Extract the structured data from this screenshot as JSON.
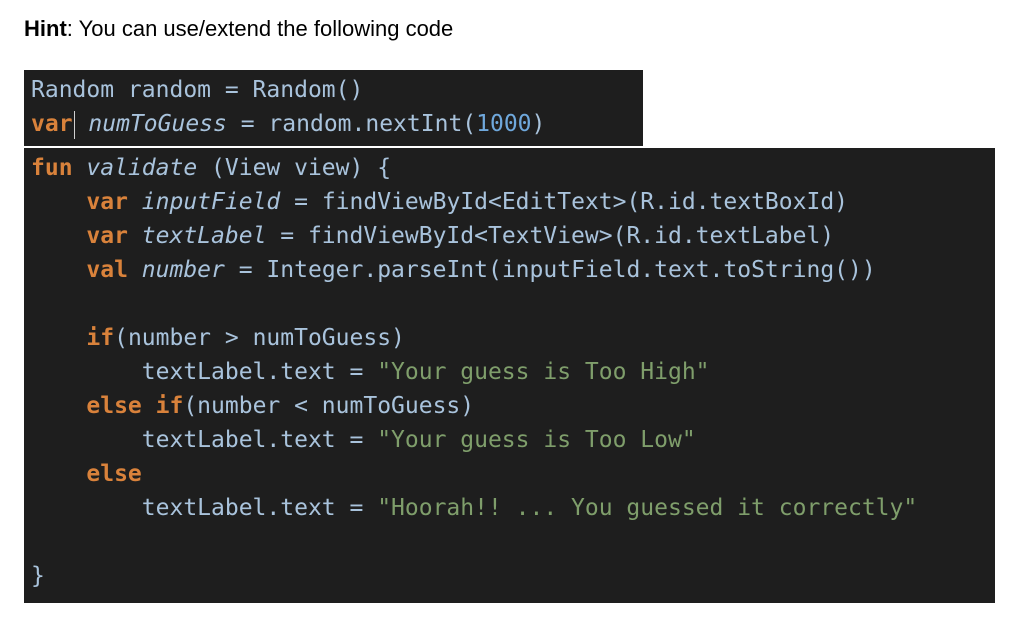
{
  "hint": {
    "label": "Hint",
    "text": ": You can use/extend the following code"
  },
  "code_block_1": {
    "lines": [
      [
        {
          "t": "Random random = Random()",
          "c": "plain"
        }
      ],
      [
        {
          "t": "var",
          "c": "kw"
        },
        {
          "t": "",
          "c": "caret"
        },
        {
          "t": " ",
          "c": "plain"
        },
        {
          "t": "numToGuess",
          "c": "fn"
        },
        {
          "t": " = random.nextInt(",
          "c": "plain"
        },
        {
          "t": "1000",
          "c": "num"
        },
        {
          "t": ")",
          "c": "plain"
        }
      ]
    ]
  },
  "code_block_2": {
    "lines": [
      [
        {
          "t": "fun",
          "c": "kw"
        },
        {
          "t": " ",
          "c": "plain"
        },
        {
          "t": "validate",
          "c": "fn"
        },
        {
          "t": " (View view) {",
          "c": "plain"
        }
      ],
      [
        {
          "t": "    ",
          "c": "plain"
        },
        {
          "t": "var",
          "c": "kw"
        },
        {
          "t": " ",
          "c": "plain"
        },
        {
          "t": "inputField",
          "c": "fn"
        },
        {
          "t": " = findViewById<EditText>(R.id.textBoxId)",
          "c": "plain"
        }
      ],
      [
        {
          "t": "    ",
          "c": "plain"
        },
        {
          "t": "var",
          "c": "kw"
        },
        {
          "t": " ",
          "c": "plain"
        },
        {
          "t": "textLabel",
          "c": "fn"
        },
        {
          "t": " = findViewById<TextView>(R.id.textLabel)",
          "c": "plain"
        }
      ],
      [
        {
          "t": "    ",
          "c": "plain"
        },
        {
          "t": "val",
          "c": "kw"
        },
        {
          "t": " ",
          "c": "plain"
        },
        {
          "t": "number",
          "c": "fn"
        },
        {
          "t": " = Integer.parseInt(inputField.text.toString())",
          "c": "plain"
        }
      ],
      [],
      [
        {
          "t": "    ",
          "c": "plain"
        },
        {
          "t": "if",
          "c": "kw"
        },
        {
          "t": "(number > numToGuess)",
          "c": "plain"
        }
      ],
      [
        {
          "t": "        textLabel.text = ",
          "c": "plain"
        },
        {
          "t": "\"Your guess is Too High\"",
          "c": "str"
        }
      ],
      [
        {
          "t": "    ",
          "c": "plain"
        },
        {
          "t": "else if",
          "c": "kw"
        },
        {
          "t": "(number < numToGuess)",
          "c": "plain"
        }
      ],
      [
        {
          "t": "        textLabel.text = ",
          "c": "plain"
        },
        {
          "t": "\"Your guess is Too Low\"",
          "c": "str"
        }
      ],
      [
        {
          "t": "    ",
          "c": "plain"
        },
        {
          "t": "else",
          "c": "kw"
        }
      ],
      [
        {
          "t": "        textLabel.text = ",
          "c": "plain"
        },
        {
          "t": "\"Hoorah!! ... You guessed it correctly\"",
          "c": "str"
        }
      ],
      [],
      [
        {
          "t": "}",
          "c": "plain"
        }
      ]
    ]
  }
}
